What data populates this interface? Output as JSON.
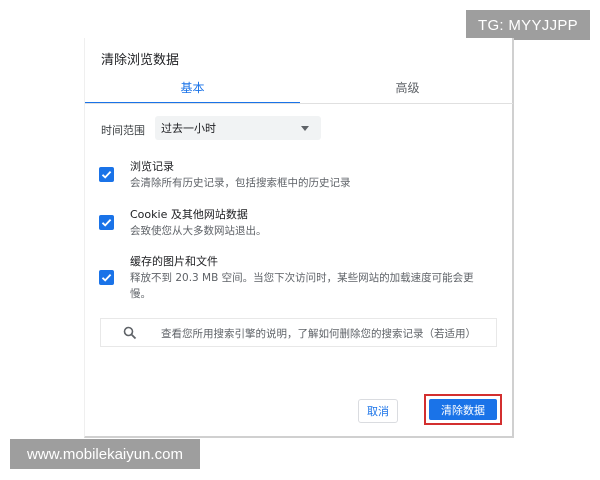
{
  "watermarks": {
    "top": "TG: MYYJJPP",
    "bottom": "www.mobilekaiyun.com"
  },
  "dialog": {
    "title": "清除浏览数据",
    "tabs": [
      {
        "label": "基本",
        "selected": true
      },
      {
        "label": "高级",
        "selected": false
      }
    ],
    "time_range": {
      "label": "时间范围",
      "value": "过去一小时"
    },
    "options": [
      {
        "title": "浏览记录",
        "desc": "会清除所有历史记录，包括搜索框中的历史记录",
        "checked": true
      },
      {
        "title": "Cookie 及其他网站数据",
        "desc": "会致使您从大多数网站退出。",
        "checked": true
      },
      {
        "title": "缓存的图片和文件",
        "desc_line1": "释放不到 20.3 MB 空间。当您下次访问时，某些网站的加载速度可能会更",
        "desc_line2": "慢。",
        "checked": true
      }
    ],
    "search_notice": "查看您所用搜索引擎的说明，了解如何删除您的搜索记录（若适用）",
    "buttons": {
      "cancel": "取消",
      "clear": "清除数据"
    }
  },
  "colors": {
    "accent": "#1a73e8",
    "highlight_border": "#d32f2f"
  }
}
